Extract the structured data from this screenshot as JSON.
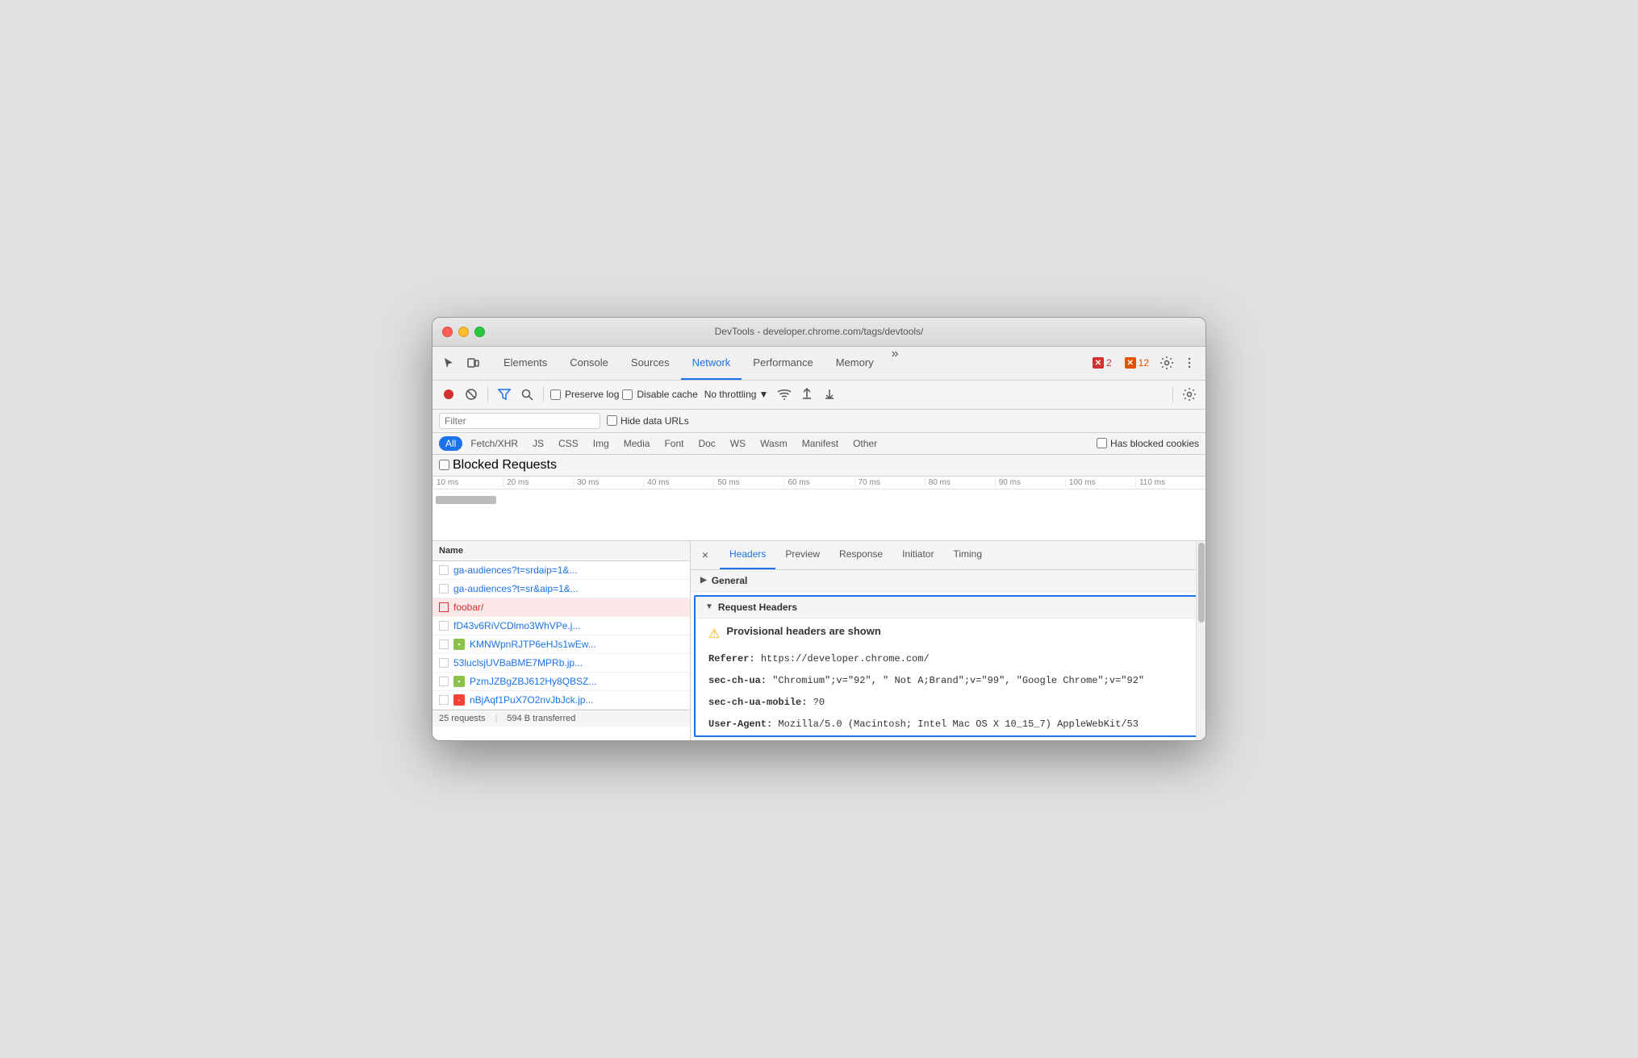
{
  "window": {
    "title": "DevTools - developer.chrome.com/tags/devtools/"
  },
  "devtools_tabs": {
    "tabs": [
      "Elements",
      "Console",
      "Sources",
      "Network",
      "Performance",
      "Memory"
    ],
    "active_tab": "Network",
    "more_icon": "»",
    "error_count": "2",
    "warning_count": "12"
  },
  "toolbar": {
    "record_tooltip": "Stop recording network log",
    "block_tooltip": "Block request URL",
    "filter_tooltip": "Filter",
    "search_tooltip": "Search",
    "preserve_log_label": "Preserve log",
    "disable_cache_label": "Disable cache",
    "throttling_label": "No throttling",
    "throttling_dropdown": "▼",
    "wifi_icon": "wifi",
    "upload_icon": "upload",
    "download_icon": "download",
    "settings_icon": "settings"
  },
  "filter_bar": {
    "placeholder": "Filter",
    "hide_data_urls_label": "Hide data URLs"
  },
  "type_filter": {
    "types": [
      "All",
      "Fetch/XHR",
      "JS",
      "CSS",
      "Img",
      "Media",
      "Font",
      "Doc",
      "WS",
      "Wasm",
      "Manifest",
      "Other"
    ],
    "active_type": "All",
    "has_blocked_cookies_label": "Has blocked cookies"
  },
  "blocked_requests": {
    "label": "Blocked Requests"
  },
  "timeline": {
    "marks": [
      "10 ms",
      "20 ms",
      "30 ms",
      "40 ms",
      "50 ms",
      "60 ms",
      "70 ms",
      "80 ms",
      "90 ms",
      "100 ms",
      "110 ms"
    ]
  },
  "file_list": {
    "header": "Name",
    "files": [
      {
        "name": "ga-audiences?t=srdaip=1&...",
        "type": "default",
        "has_checkbox": true
      },
      {
        "name": "ga-audiences?t=sr&aip=1&...",
        "type": "default",
        "has_checkbox": true
      },
      {
        "name": "foobar/",
        "type": "selected",
        "has_checkbox": true
      },
      {
        "name": "fD43v6RiVCDlmo3WhVPe.j...",
        "type": "default",
        "has_checkbox": true
      },
      {
        "name": "KMNWpnRJTP6eHJs1wEw...",
        "type": "img",
        "has_checkbox": true
      },
      {
        "name": "53luclsjUVBaBME7MPRb.jp...",
        "type": "default",
        "has_checkbox": true
      },
      {
        "name": "PzmJZBgZBJ612Hy8QBSZ...",
        "type": "img",
        "has_checkbox": true
      },
      {
        "name": "nBjAqf1PuX7O2nvJbJck.jp...",
        "type": "minus",
        "has_checkbox": true
      }
    ]
  },
  "status_bar": {
    "requests": "25 requests",
    "transferred": "594 B transferred"
  },
  "details": {
    "close_icon": "×",
    "tabs": [
      "Headers",
      "Preview",
      "Response",
      "Initiator",
      "Timing"
    ],
    "active_tab": "Headers",
    "general_section": {
      "label": "General",
      "collapsed": false
    },
    "request_headers_section": {
      "label": "Request Headers",
      "provisional_warning": "Provisional headers are shown",
      "headers": [
        {
          "name": "Referer:",
          "value": "https://developer.chrome.com/"
        },
        {
          "name": "sec-ch-ua:",
          "value": "\"Chromium\";v=\"92\", \" Not A;Brand\";v=\"99\", \"Google Chrome\";v=\"92\""
        },
        {
          "name": "sec-ch-ua-mobile:",
          "value": "?0"
        },
        {
          "name": "User-Agent:",
          "value": "Mozilla/5.0 (Macintosh; Intel Mac OS X 10_15_7) AppleWebKit/53"
        }
      ]
    }
  }
}
